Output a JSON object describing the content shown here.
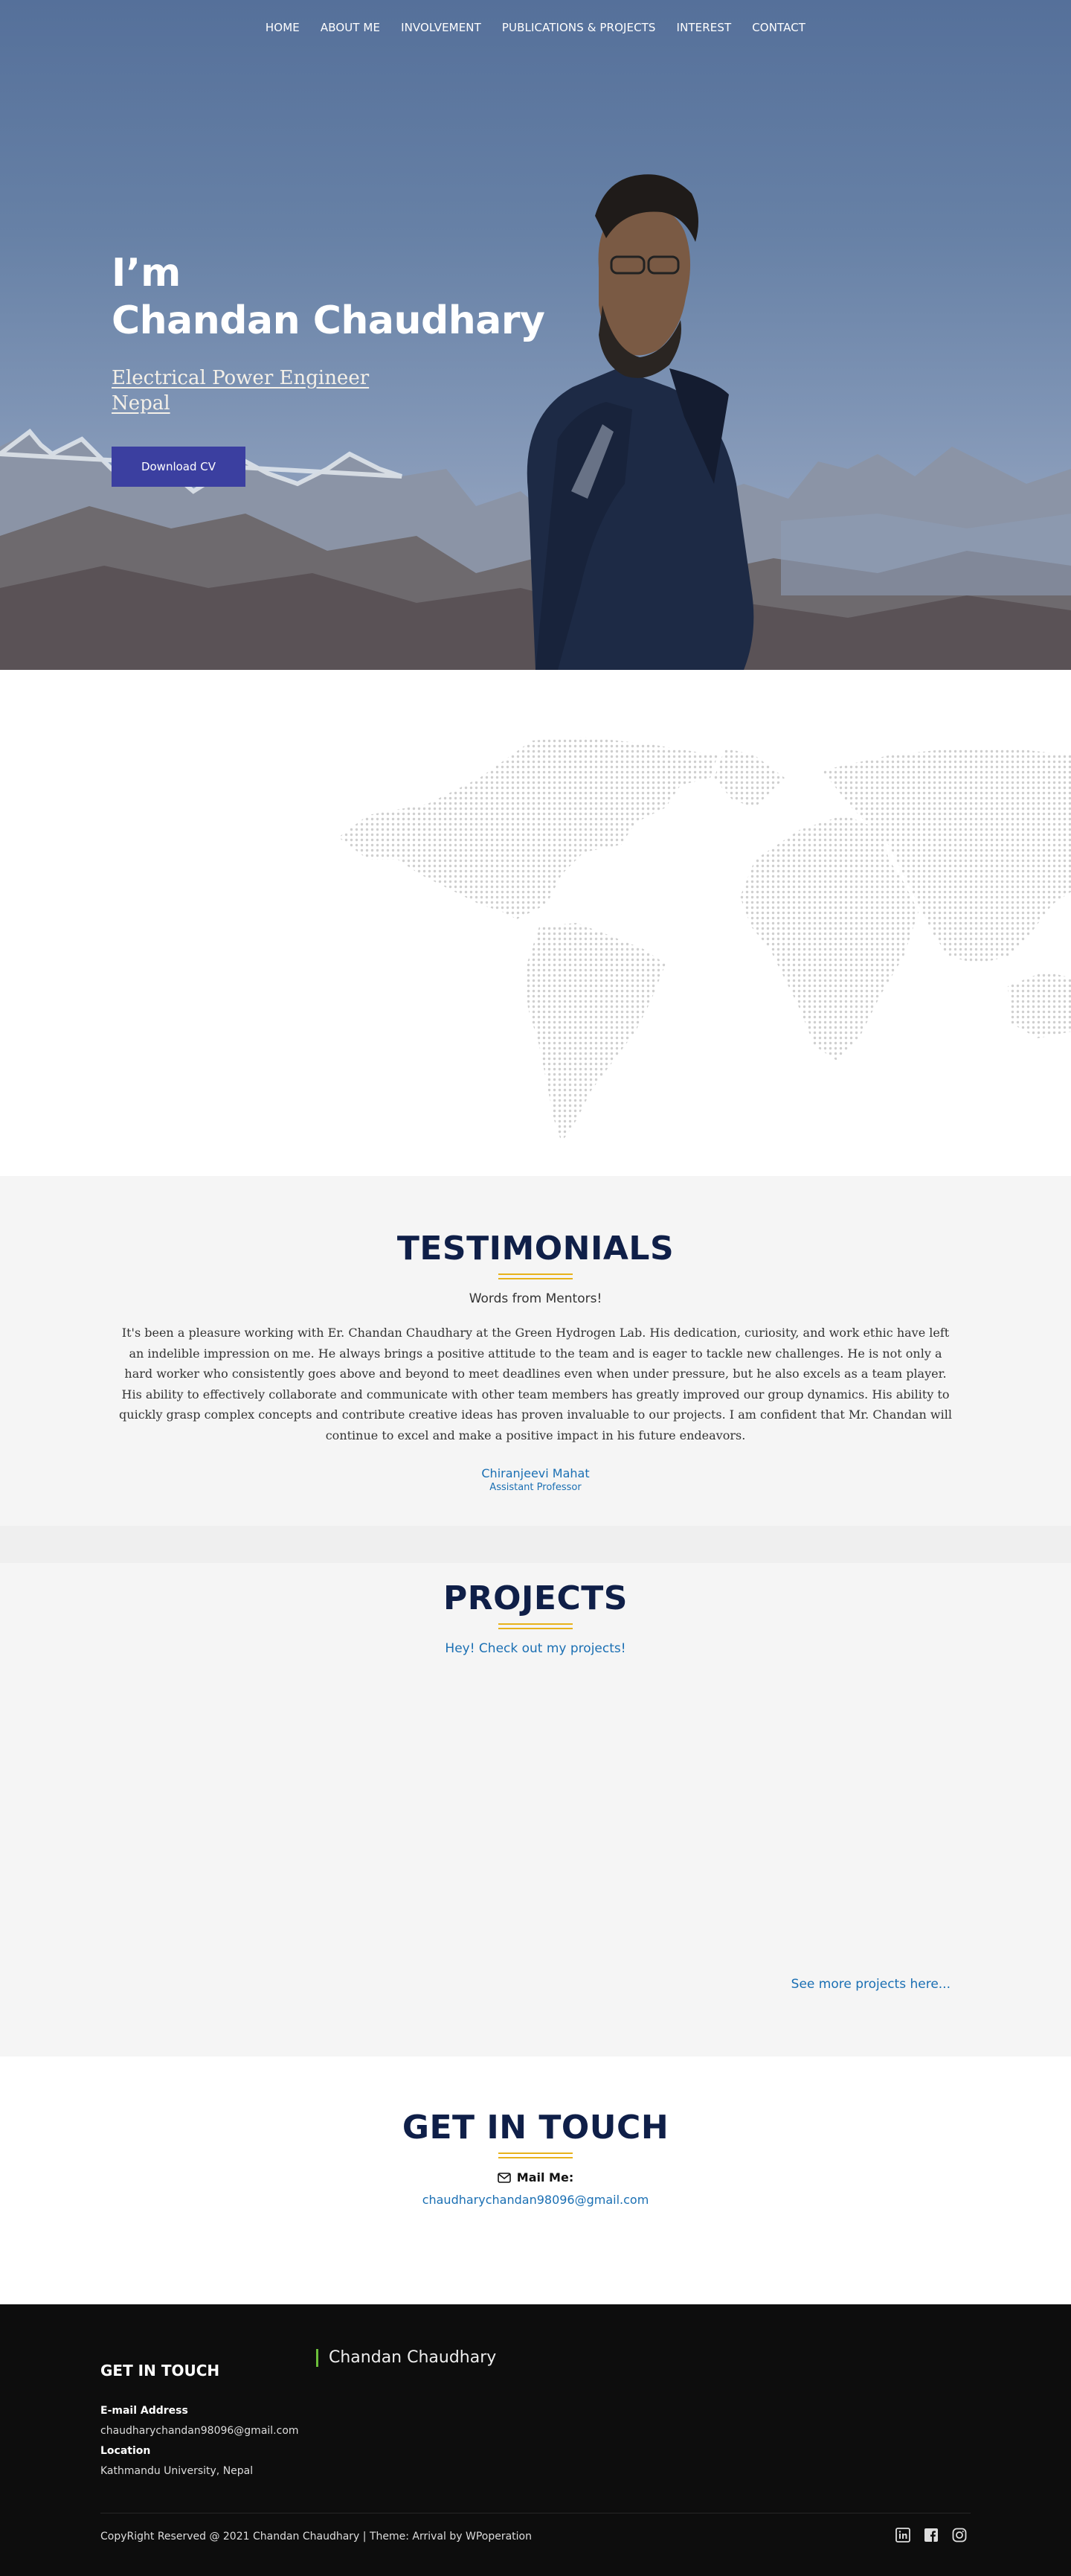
{
  "nav": {
    "items": [
      "HOME",
      "ABOUT ME",
      "INVOLVEMENT",
      "PUBLICATIONS & PROJECTS",
      "INTEREST",
      "CONTACT"
    ]
  },
  "hero": {
    "greeting": "I’m",
    "name": "Chandan Chaudhary",
    "role_line1": "Electrical Power Engineer",
    "role_line2": "Nepal",
    "cv_button": "Download CV"
  },
  "testimonials": {
    "title": "TESTIMONIALS",
    "subtitle": "Words from Mentors!",
    "quote": "It's been a pleasure working with Er. Chandan Chaudhary at the Green Hydrogen Lab. His dedication, curiosity, and work ethic have left an indelible impression on me. He always brings a positive attitude to the team and is eager to tackle new challenges. He is not only a hard worker who consistently goes above and beyond to meet deadlines even when under pressure, but he also excels as a team player. His ability to effectively collaborate and communicate with other team members has greatly improved our group dynamics. His ability to quickly grasp complex concepts and contribute creative ideas has proven invaluable to our projects. I am confident that Mr. Chandan will continue to excel and make a positive impact in his future endeavors.",
    "mentor_name": "Chiranjeevi Mahat",
    "mentor_role": "Assistant Professor"
  },
  "projects": {
    "title": "PROJECTS",
    "subtitle": "Hey! Check out my projects!",
    "more_link": "See more projects here..."
  },
  "contact": {
    "title": "GET IN TOUCH",
    "mail_label": "Mail Me:",
    "email": "chaudharychandan98096@gmail.com"
  },
  "footer": {
    "title": "GET IN TOUCH",
    "name": "Chandan Chaudhary",
    "email_label": "E-mail Address",
    "email": "chaudharychandan98096@gmail.com",
    "location_label": "Location",
    "location": "Kathmandu University, Nepal",
    "copyright": "CopyRight Reserved @ 2021 Chandan Chaudhary | Theme: Arrival by WPoperation",
    "social": [
      "linkedin-icon",
      "facebook-icon",
      "instagram-icon"
    ]
  },
  "colors": {
    "navy": "#0f1f48",
    "accent_gold": "#e8b21b",
    "link_blue": "#1a6fb3",
    "button_indigo": "#3b3fa0",
    "footer_bg": "#0d0d0d"
  }
}
